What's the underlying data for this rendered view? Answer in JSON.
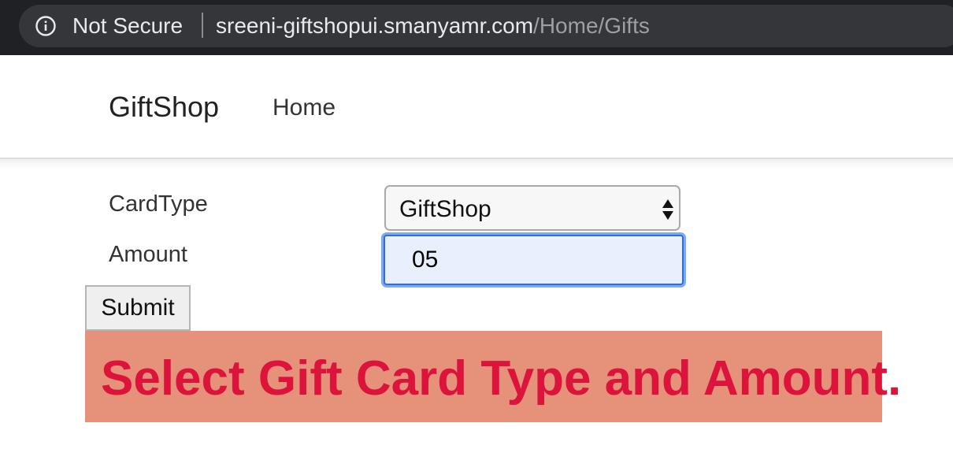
{
  "browser": {
    "security_label": "Not Secure",
    "info_icon": "info-circle-icon",
    "url_host": "sreeni-giftshopui.smanyamr.com",
    "url_path": "/Home/Gifts"
  },
  "navbar": {
    "brand": "GiftShop",
    "links": [
      {
        "label": "Home"
      }
    ]
  },
  "form": {
    "card_type_label": "CardType",
    "card_type_selected": "GiftShop",
    "amount_label": "Amount",
    "amount_value": "05",
    "submit_label": "Submit"
  },
  "alert": {
    "message": "Select Gift Card Type and Amount.",
    "background_color": "#e6917a",
    "text_color": "#dc143c"
  }
}
